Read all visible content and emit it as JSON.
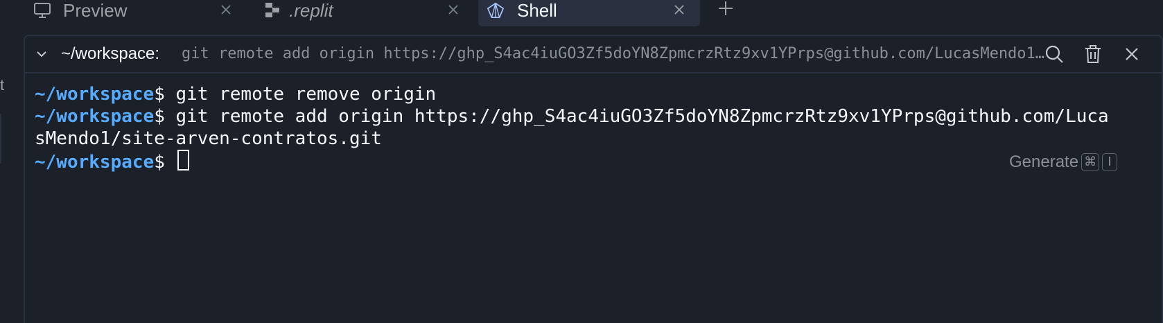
{
  "tabs": [
    {
      "label": "Preview",
      "icon": "monitor-icon"
    },
    {
      "label": ".replit",
      "icon": "replit-file-icon"
    },
    {
      "label": "Shell",
      "icon": "shell-icon",
      "active": true
    }
  ],
  "panel": {
    "header_path": "~/workspace:",
    "header_command": "git remote add origin https://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@github.com/LucasMendo1/site-arven-contratos.git"
  },
  "terminal": {
    "prompt": "~/workspace",
    "lines": [
      {
        "prompt": "~/workspace",
        "symbol": "$",
        "text": " git remote remove origin"
      },
      {
        "prompt": "~/workspace",
        "symbol": "$",
        "text": " git remote add origin https://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@github.com/Luca"
      },
      {
        "prompt": "",
        "symbol": "",
        "text": "sMendo1/site-arven-contratos.git"
      },
      {
        "prompt": "~/workspace",
        "symbol": "$",
        "text": " "
      }
    ]
  },
  "generate": {
    "label": "Generate",
    "key1": "⌘",
    "key2": "I"
  },
  "left_strip_glyph": "t",
  "colors": {
    "background": "#1c2029",
    "active_tab": "#2b3040",
    "prompt": "#57abff",
    "text": "#f5f9fc",
    "muted": "#8a8f98"
  }
}
